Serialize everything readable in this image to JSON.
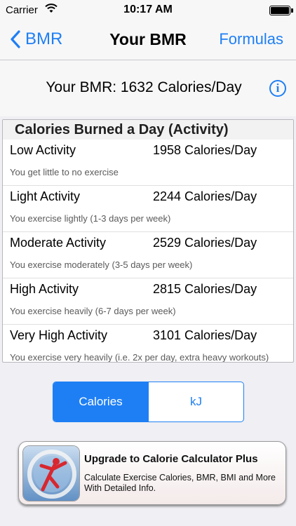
{
  "status_bar": {
    "carrier": "Carrier",
    "time": "10:17 AM"
  },
  "nav": {
    "back_label": "BMR",
    "title": "Your BMR",
    "right_label": "Formulas"
  },
  "bmr": {
    "text": "Your BMR: 1632 Calories/Day",
    "info_symbol": "i"
  },
  "activity": {
    "header": "Calories Burned a Day (Activity)",
    "rows": [
      {
        "name": "Low Activity",
        "value": "1958 Calories/Day",
        "desc": "You get little to no exercise"
      },
      {
        "name": "Light Activity",
        "value": "2244 Calories/Day",
        "desc": "You exercise lightly (1-3 days per week)"
      },
      {
        "name": "Moderate Activity",
        "value": "2529 Calories/Day",
        "desc": "You exercise moderately (3-5 days per week)"
      },
      {
        "name": "High Activity",
        "value": "2815 Calories/Day",
        "desc": "You exercise heavily (6-7 days per week)"
      },
      {
        "name": "Very High Activity",
        "value": "3101 Calories/Day",
        "desc": "You exercise very heavily (i.e. 2x per day, extra heavy workouts)"
      }
    ]
  },
  "units": {
    "options": [
      "Calories",
      "kJ"
    ],
    "selected": "Calories"
  },
  "banner": {
    "title": "Upgrade to Calorie Calculator Plus",
    "description": "Calculate Exercise Calories, BMR, BMI and More With Detailed Info."
  },
  "colors": {
    "accent": "#1e7ff5",
    "background": "#efeff4"
  },
  "icons": [
    "wifi-icon",
    "battery-icon",
    "back-chevron-icon",
    "info-icon",
    "app-icon"
  ]
}
